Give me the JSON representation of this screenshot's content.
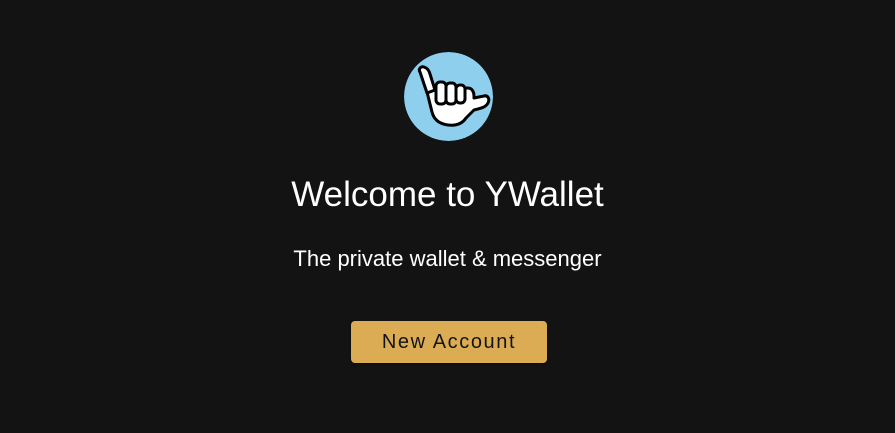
{
  "welcome": {
    "logo_icon": "shaka-hand-icon",
    "title": "Welcome to YWallet",
    "subtitle": "The private wallet & messenger",
    "new_account_label": "New Account"
  },
  "colors": {
    "background": "#131313",
    "logo_circle": "#8ecfee",
    "button": "#dcac55",
    "button_text": "#141414",
    "text": "#ffffff"
  }
}
